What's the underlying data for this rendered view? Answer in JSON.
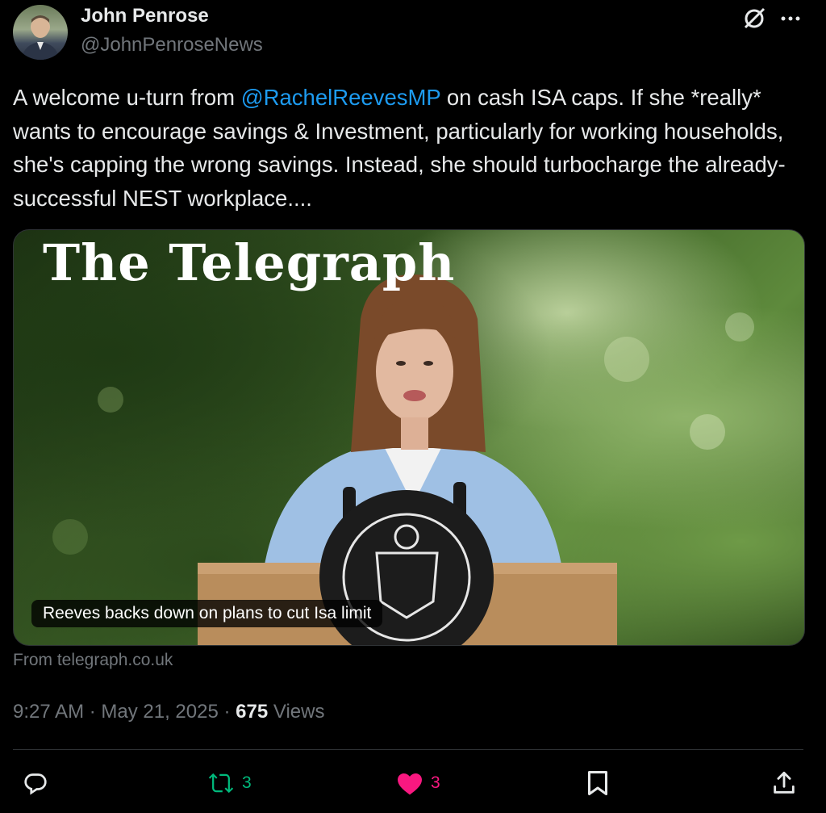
{
  "author": {
    "display_name": "John Penrose",
    "handle": "@JohnPenroseNews"
  },
  "header_icons": [
    "grok-icon",
    "more-icon"
  ],
  "tweet": {
    "text_before_mention": "A welcome u-turn from ",
    "mention": "@RachelReevesMP",
    "text_after_mention": " on cash ISA caps. If she *really* wants to encourage savings & Investment, particularly for working households, she's capping the wrong savings. Instead, she should turbocharge the already-successful NEST workplace....",
    "mention_color": "#1d9bf0"
  },
  "card": {
    "logo": "The Telegraph",
    "caption": "Reeves backs down on plans to cut Isa limit",
    "source": "From telegraph.co.uk"
  },
  "meta": {
    "time": "9:27 AM",
    "separator": " · ",
    "date": "May 21, 2025",
    "views_count": "675",
    "views_label": " Views"
  },
  "actions": {
    "reply": {
      "icon": "reply-icon",
      "count": ""
    },
    "retweet": {
      "icon": "retweet-icon",
      "count": "3",
      "color": "#00ba7c"
    },
    "like": {
      "icon": "heart-icon",
      "count": "3",
      "color": "#f91880"
    },
    "bookmark": {
      "icon": "bookmark-icon"
    },
    "share": {
      "icon": "share-icon"
    }
  }
}
